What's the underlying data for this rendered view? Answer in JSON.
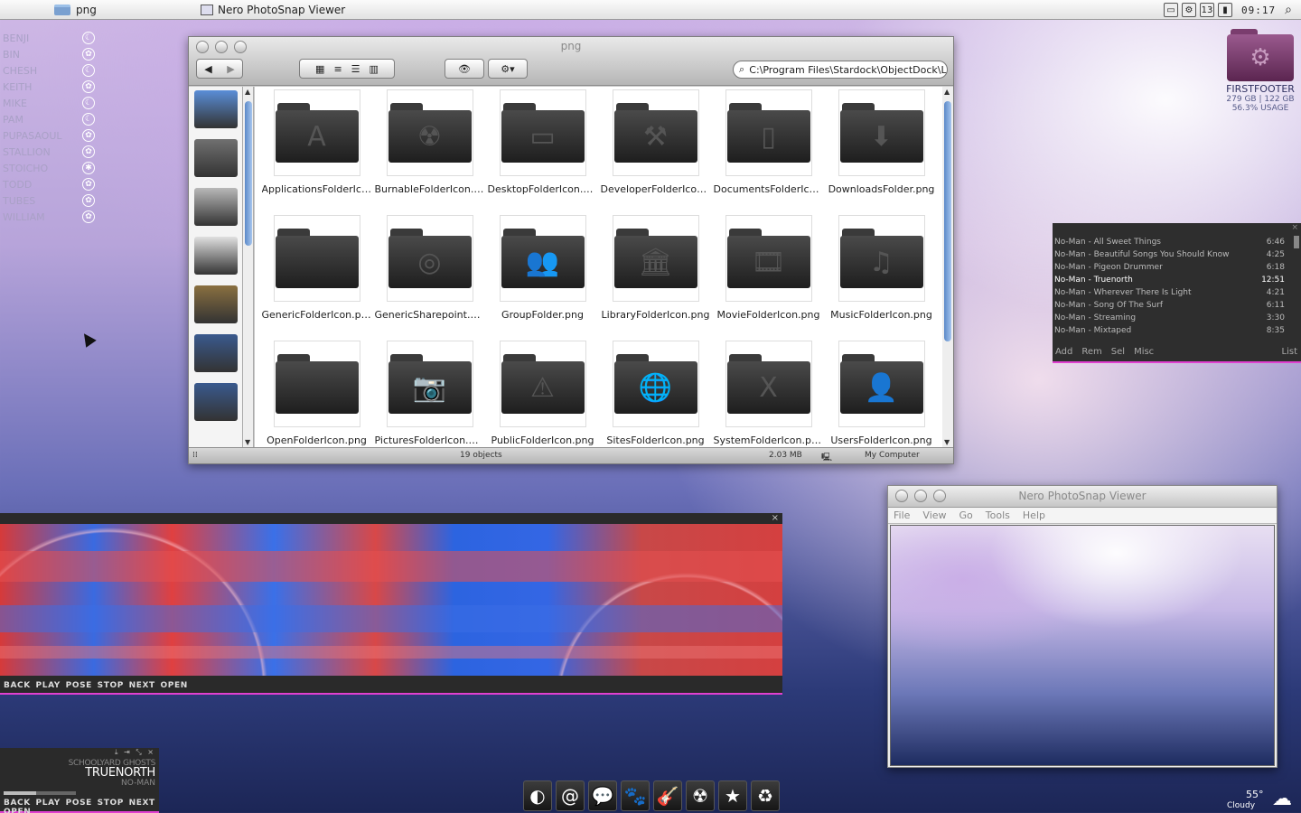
{
  "menubar": {
    "apple_icon": "apple-logo",
    "folder_title": "png",
    "app_title": "Nero PhotoSnap Viewer",
    "clock": "09:17",
    "tray_badge": "13"
  },
  "buddies": [
    {
      "name": "BENJI",
      "status": "away"
    },
    {
      "name": "BIN",
      "status": "online"
    },
    {
      "name": "CHESH",
      "status": "away"
    },
    {
      "name": "KEITH",
      "status": "online"
    },
    {
      "name": "MIKE",
      "status": "away"
    },
    {
      "name": "PAM",
      "status": "away"
    },
    {
      "name": "PUPASAOUL",
      "status": "online"
    },
    {
      "name": "STALLION",
      "status": "online"
    },
    {
      "name": "STOICHO",
      "status": "busy"
    },
    {
      "name": "TODD",
      "status": "online"
    },
    {
      "name": "TUBES",
      "status": "online"
    },
    {
      "name": "WILLIAM",
      "status": "online"
    }
  ],
  "explorer": {
    "title": "png",
    "address": "C:\\Program Files\\Stardock\\ObjectDock\\Leopard",
    "status_objects": "19 objects",
    "status_size": "2.03 MB",
    "status_location": "My Computer",
    "sidebar": [
      {
        "name": "imac-icon",
        "color": "#5a8ed8"
      },
      {
        "name": "system-preferences-icon",
        "color": "#707070"
      },
      {
        "name": "hard-drive-icon",
        "color": "#b8b8b8"
      },
      {
        "name": "dvd-icon",
        "color": "#e0e0e0"
      },
      {
        "name": "burn-folder-icon",
        "color": "#8a7040"
      },
      {
        "name": "user-folder-icon",
        "color": "#3a5a8e"
      },
      {
        "name": "music-folder-icon",
        "color": "#3a5a8e"
      }
    ],
    "files": [
      {
        "label": "ApplicationsFolderIcon....",
        "glyph": "A"
      },
      {
        "label": "BurnableFolderIcon.png",
        "glyph": "☢"
      },
      {
        "label": "DesktopFolderIcon.png",
        "glyph": "▭"
      },
      {
        "label": "DeveloperFolderIcon.png",
        "glyph": "⚒"
      },
      {
        "label": "DocumentsFolderIcon.p...",
        "glyph": "▯"
      },
      {
        "label": "DownloadsFolder.png",
        "glyph": "⬇"
      },
      {
        "label": "GenericFolderIcon.png",
        "glyph": ""
      },
      {
        "label": "GenericSharepoint.png",
        "glyph": "◎"
      },
      {
        "label": "GroupFolder.png",
        "glyph": "👥"
      },
      {
        "label": "LibraryFolderIcon.png",
        "glyph": "🏛"
      },
      {
        "label": "MovieFolderIcon.png",
        "glyph": "🎞"
      },
      {
        "label": "MusicFolderIcon.png",
        "glyph": "♫"
      },
      {
        "label": "OpenFolderIcon.png",
        "glyph": ""
      },
      {
        "label": "PicturesFolderIcon.png",
        "glyph": "📷"
      },
      {
        "label": "PublicFolderIcon.png",
        "glyph": "⚠"
      },
      {
        "label": "SitesFolderIcon.png",
        "glyph": "🌐"
      },
      {
        "label": "SystemFolderIcon.png",
        "glyph": "X"
      },
      {
        "label": "UsersFolderIcon.png",
        "glyph": "👤"
      }
    ]
  },
  "drive": {
    "name": "FIRSTFOOTER",
    "capacity": "279 GB | 122 GB",
    "usage": "56.3% USAGE"
  },
  "playlist": {
    "tracks": [
      {
        "title": "No-Man - All Sweet Things",
        "time": "6:46"
      },
      {
        "title": "No-Man - Beautiful Songs You Should Know",
        "time": "4:25"
      },
      {
        "title": "No-Man - Pigeon Drummer",
        "time": "6:18"
      },
      {
        "title": "No-Man - Truenorth",
        "time": "12:51",
        "current": true
      },
      {
        "title": "No-Man - Wherever There Is Light",
        "time": "4:21"
      },
      {
        "title": "No-Man - Song Of The Surf",
        "time": "6:11"
      },
      {
        "title": "No-Man - Streaming",
        "time": "3:30"
      },
      {
        "title": "No-Man - Mixtaped",
        "time": "8:35"
      }
    ],
    "buttons": {
      "add": "Add",
      "rem": "Rem",
      "sel": "Sel",
      "misc": "Misc",
      "list": "List"
    },
    "close": "×"
  },
  "visualizer": {
    "controls": "BACK PLAY POSE STOP NEXT OPEN",
    "close": "×"
  },
  "mini_player": {
    "album": "SCHOOLYARD GHOSTS",
    "song": "TRUENORTH",
    "artist": "NO-MAN",
    "controls": "BACK PLAY POSE STOP NEXT OPEN",
    "window_ctrls": "⤓ ⇥ ⤡ ×",
    "progress": 0.45
  },
  "nero": {
    "title": "Nero PhotoSnap Viewer",
    "menus": [
      "File",
      "View",
      "Go",
      "Tools",
      "Help"
    ]
  },
  "dock": [
    {
      "name": "moon-icon",
      "glyph": "◐"
    },
    {
      "name": "mail-at-icon",
      "glyph": "@"
    },
    {
      "name": "chat-bubble-icon",
      "glyph": "💬"
    },
    {
      "name": "paw-icon",
      "glyph": "🐾"
    },
    {
      "name": "guitar-icon",
      "glyph": "🎸"
    },
    {
      "name": "radiation-icon",
      "glyph": "☢"
    },
    {
      "name": "star-icon",
      "glyph": "★"
    },
    {
      "name": "recycle-icon",
      "glyph": "♻"
    }
  ],
  "weather": {
    "temp": "55°",
    "condition": "Cloudy"
  },
  "colors": {
    "accent": "#e040d0",
    "scroll_thumb": "#5b88c8"
  }
}
